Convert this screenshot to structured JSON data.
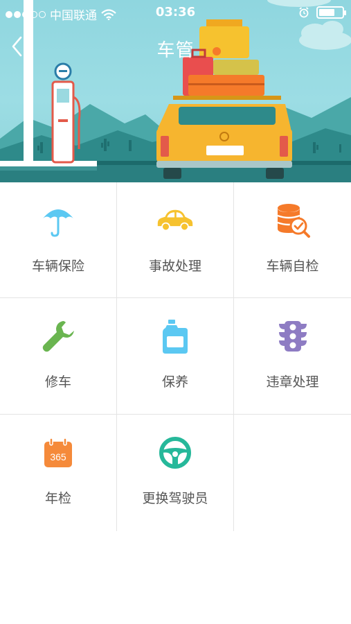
{
  "status_bar": {
    "carrier": "中国联通",
    "time": "03:36",
    "signal_bars_filled": 3,
    "signal_bars_total": 5,
    "battery_level": 0.7
  },
  "nav": {
    "title": "车管",
    "back_icon": "chevron-left-icon"
  },
  "colors": {
    "banner_sky": "#9cdde4",
    "label_text": "#555555",
    "divider": "#e4e4e4"
  },
  "menu": [
    {
      "label": "车辆保险",
      "icon": "umbrella-icon",
      "color": "#5bc8f2"
    },
    {
      "label": "事故处理",
      "icon": "car-icon",
      "color": "#f6c22f"
    },
    {
      "label": "车辆自检",
      "icon": "database-check-icon",
      "color": "#f57a2a"
    },
    {
      "label": "修车",
      "icon": "wrench-icon",
      "color": "#6ab550"
    },
    {
      "label": "保养",
      "icon": "oil-bottle-icon",
      "color": "#5bc8f2"
    },
    {
      "label": "违章处理",
      "icon": "traffic-light-icon",
      "color": "#8e7cc3"
    },
    {
      "label": "年检",
      "icon": "calendar-icon",
      "color": "#f58a3a",
      "badge": "365"
    },
    {
      "label": "更换驾驶员",
      "icon": "steering-wheel-icon",
      "color": "#26b89a"
    }
  ]
}
